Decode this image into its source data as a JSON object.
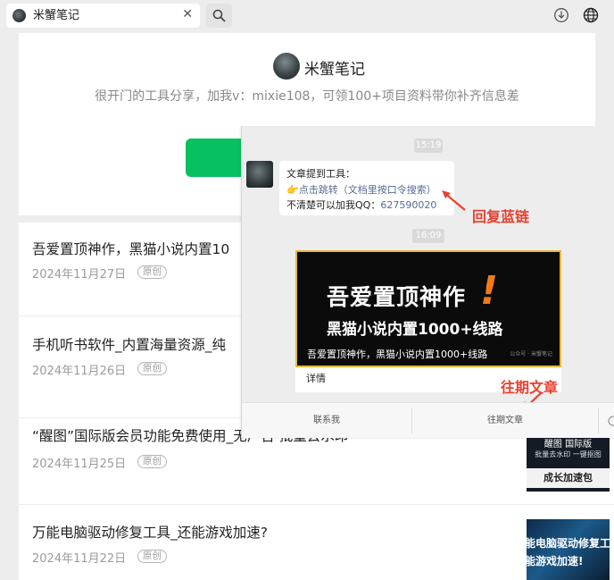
{
  "browser": {
    "tab_title": "米蟹笔记",
    "tab_close": "✕",
    "search_icon": "search-icon",
    "download_icon": "download-icon",
    "globe_icon": "globe-icon"
  },
  "profile": {
    "name": "米蟹笔记",
    "description": "很开门的工具分享，加我v：mixie108，可领100+项目资料带你补齐信息差",
    "follow_button_color": "#07c160"
  },
  "articles": [
    {
      "title": "吾爱置顶神作，黑猫小说内置10",
      "date": "2024年11月27日",
      "badge": "原创"
    },
    {
      "title": "手机听书软件_内置海量资源_纯",
      "date": "2024年11月26日",
      "badge": "原创"
    },
    {
      "title": "“醒图”国际版会员功能免费使用_无广告 批量去水印",
      "date": "2024年11月25日",
      "badge": "原创",
      "thumb_top": "醒图 国际版",
      "thumb_mid": "批量去水印 一键抠图",
      "thumb_label": "成长加速包"
    },
    {
      "title": "万能电脑驱动修复工具_还能游戏加速?",
      "date": "2024年11月22日",
      "badge": "原创",
      "thumb_l1": "能电脑驱动修复工",
      "thumb_l2": "能游戏加速!"
    }
  ],
  "chat": {
    "time1": "15:19",
    "bubble_line1": "文章提到工具：",
    "bubble_link": "👉点击跳转（文档里按口令搜索）",
    "bubble_line3_prefix": "不清楚可以加我QQ：",
    "bubble_qq": "627590020",
    "annotation1": "回复蓝链",
    "time2": "16:09",
    "card_title1": "吾爱置顶神作",
    "card_bang": "!",
    "card_title2": "黑猫小说内置1000+线路",
    "card_caption": "吾爱置顶神作，黑猫小说内置1000+线路",
    "card_source": "公众号 · 米蟹笔记",
    "card_detail": "详情",
    "annotation2": "往期文章",
    "menu_left": "联系我",
    "menu_mid": "往期文章",
    "annotation_color": "#e8402e"
  }
}
